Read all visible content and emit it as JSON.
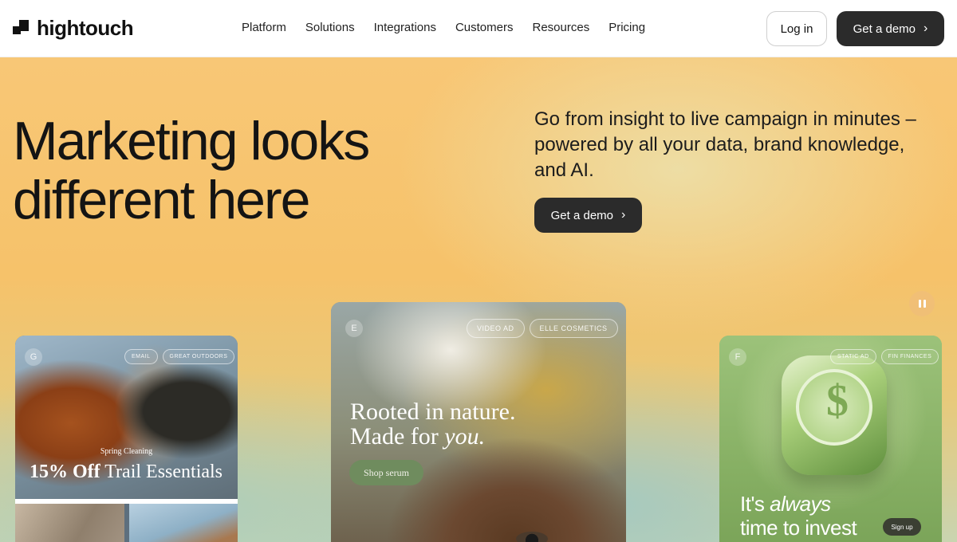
{
  "nav": {
    "logo_text": "hightouch",
    "menu": [
      "Platform",
      "Solutions",
      "Integrations",
      "Customers",
      "Resources",
      "Pricing"
    ],
    "login_label": "Log in",
    "demo_label": "Get a demo"
  },
  "hero": {
    "headline_line1": "Marketing looks",
    "headline_line2": "different here",
    "subcopy": "Go from insight to live campaign in minutes – powered by all your data, brand knowledge, and AI.",
    "demo_label": "Get a demo"
  },
  "cards": {
    "g": {
      "letter": "G",
      "tags": [
        "EMAIL",
        "GREAT OUTDOORS"
      ],
      "eyebrow": "Spring Cleaning",
      "offer_bold": "15% Off",
      "offer_rest": "Trail Essentials"
    },
    "e": {
      "letter": "E",
      "tags": [
        "VIDEO AD",
        "ELLE COSMETICS"
      ],
      "headline_line1": "Rooted in nature.",
      "headline_line2_prefix": "Made for ",
      "headline_line2_emph": "you.",
      "button": "Shop serum"
    },
    "f": {
      "letter": "F",
      "tags": [
        "STATIC AD",
        "FIN FINANCES"
      ],
      "symbol": "$",
      "text_line1_prefix": "It's ",
      "text_line1_emph": "always",
      "text_line2": "time to invest",
      "button": "Sign up"
    }
  },
  "colors": {
    "brand_dark": "#2b2b2b",
    "hero_orange": "#f8c776",
    "hero_teal": "#a8cdbe"
  },
  "icons": {
    "chevron": "chevron-right-icon",
    "pause": "pause-icon"
  }
}
